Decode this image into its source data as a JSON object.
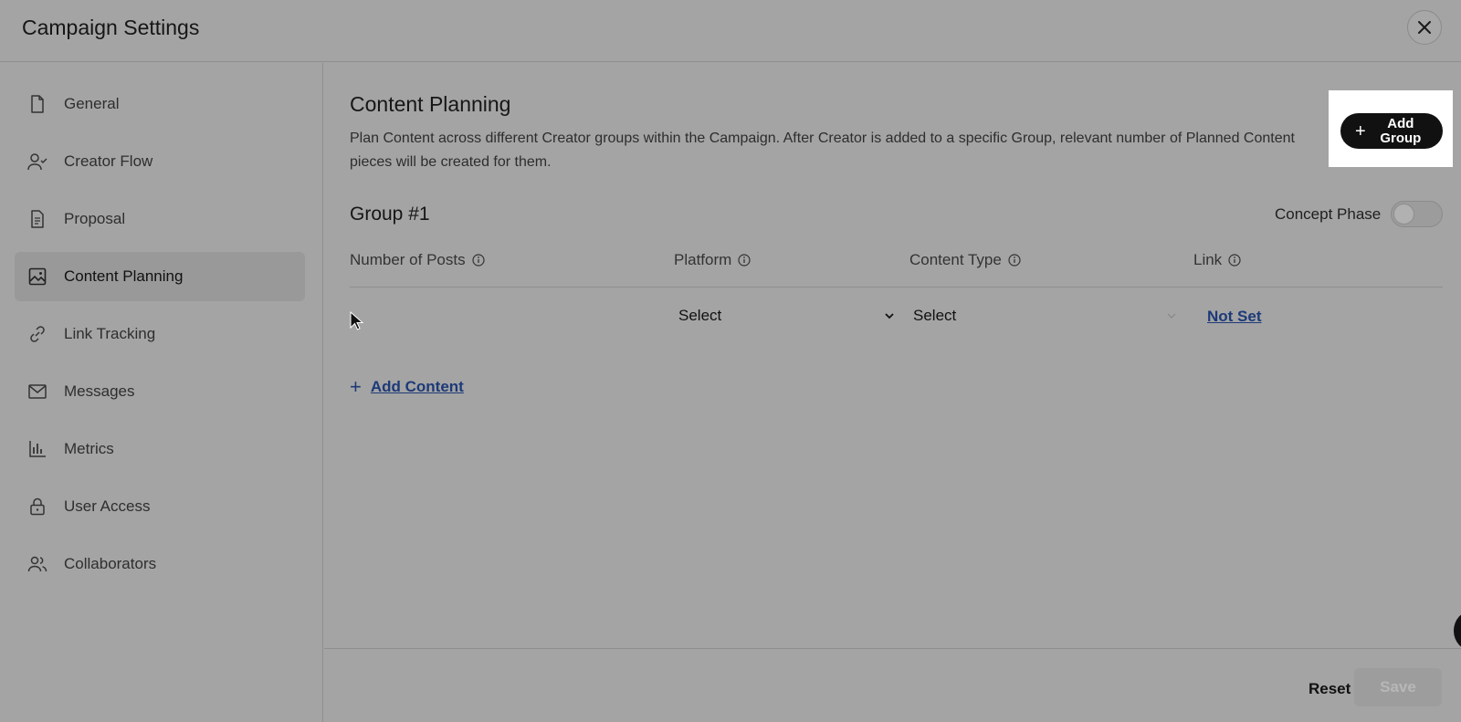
{
  "header": {
    "title": "Campaign Settings",
    "close_icon": "close-icon"
  },
  "sidebar": {
    "items": [
      {
        "label": "General",
        "icon": "file-icon",
        "active": false
      },
      {
        "label": "Creator Flow",
        "icon": "user-check-icon",
        "active": false
      },
      {
        "label": "Proposal",
        "icon": "document-icon",
        "active": false
      },
      {
        "label": "Content Planning",
        "icon": "image-icon",
        "active": true
      },
      {
        "label": "Link Tracking",
        "icon": "link-icon",
        "active": false
      },
      {
        "label": "Messages",
        "icon": "mail-icon",
        "active": false
      },
      {
        "label": "Metrics",
        "icon": "bar-chart-icon",
        "active": false
      },
      {
        "label": "User Access",
        "icon": "lock-icon",
        "active": false
      },
      {
        "label": "Collaborators",
        "icon": "users-icon",
        "active": false
      }
    ]
  },
  "main": {
    "title": "Content Planning",
    "description": "Plan Content across different Creator groups within the Campaign. After Creator is added to a specific Group, relevant number of Planned Content pieces will be created for them.",
    "add_group_label": "Add Group",
    "group": {
      "title": "Group #1",
      "concept_phase_label": "Concept Phase",
      "concept_phase_on": false,
      "columns": [
        "Number of Posts",
        "Platform",
        "Content Type",
        "Link"
      ],
      "row": {
        "number_of_posts": "",
        "platform": "Select",
        "content_type": "Select",
        "link": "Not Set"
      },
      "add_content_label": "Add Content"
    }
  },
  "footer": {
    "reset_label": "Reset",
    "save_label": "Save"
  },
  "colors": {
    "overlay_bg": "#a4a4a4",
    "link": "#1d3a78",
    "primary_button": "#111111"
  }
}
